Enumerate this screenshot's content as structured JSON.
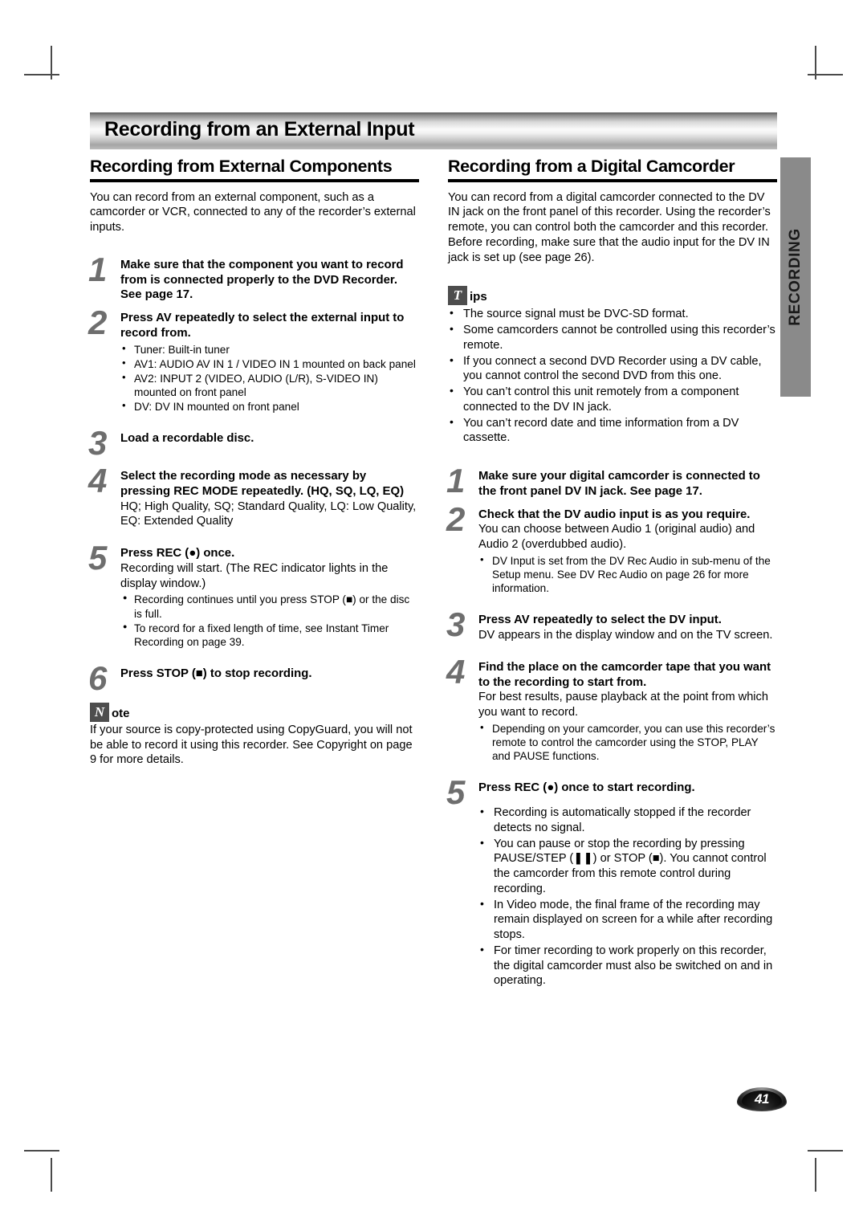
{
  "banner": {
    "title": "Recording from an External Input"
  },
  "side_tab": {
    "label": "RECORDING"
  },
  "page_number": "41",
  "left_column": {
    "heading": "Recording from External Components",
    "intro": "You can record from an external component, such as a camcorder or VCR, connected to any of the recorder’s external inputs.",
    "steps": [
      {
        "number": "1",
        "title": "Make sure that the component you want to record from is connected properly to the DVD Recorder. See page 17."
      },
      {
        "number": "2",
        "title": "Press AV repeatedly to select the external input to record from.",
        "bullets": [
          "Tuner: Built-in tuner",
          "AV1: AUDIO AV IN 1 / VIDEO IN 1 mounted on back panel",
          "AV2: INPUT 2 (VIDEO, AUDIO (L/R), S-VIDEO IN) mounted on front panel",
          "DV: DV IN mounted on front panel"
        ]
      },
      {
        "number": "3",
        "title": "Load a recordable disc."
      },
      {
        "number": "4",
        "title": "Select the recording mode as necessary by pressing REC MODE repeatedly. (HQ, SQ, LQ, EQ)",
        "sub": "HQ; High Quality, SQ; Standard Quality, LQ: Low Quality, EQ: Extended Quality"
      },
      {
        "number": "5",
        "title": "Press REC (●) once.",
        "sub": "Recording will start. (The REC indicator lights in the display window.)",
        "bullets": [
          "Recording continues until you press STOP (■) or the disc is full.",
          "To record for a fixed length of time, see Instant Timer Recording on page 39."
        ]
      },
      {
        "number": "6",
        "title": "Press STOP (■) to stop recording."
      }
    ],
    "note": {
      "badge": "N",
      "word": "ote",
      "text": "If your source is copy-protected using CopyGuard, you will not be able to record it using this recorder. See Copyright on page 9 for more details."
    }
  },
  "right_column": {
    "heading": "Recording from a Digital Camcorder",
    "intro_1": "You can record from a digital camcorder connected to the DV IN jack on the front panel of this recorder. Using the recorder’s remote, you can control both the camcorder and this recorder.",
    "intro_2": "Before recording, make sure that the audio input for the DV IN jack is set up (see page 26).",
    "tips": {
      "badge": "T",
      "word": "ips",
      "bullets": [
        "The source signal must be DVC-SD format.",
        "Some camcorders cannot be controlled using this recorder’s remote.",
        "If you connect a second DVD Recorder using a DV cable, you cannot control the second DVD from this one.",
        "You can’t control this unit remotely from a component connected to the DV IN jack.",
        "You can’t record date and time information from a DV cassette."
      ]
    },
    "steps": [
      {
        "number": "1",
        "title": "Make sure your digital camcorder is connected to the front panel DV IN jack. See page 17."
      },
      {
        "number": "2",
        "title": "Check that the DV audio input is as you require.",
        "sub": "You can choose between Audio 1 (original audio) and Audio 2 (overdubbed audio).",
        "bullets": [
          "DV Input is set from the DV Rec Audio in sub-menu of the Setup menu. See DV Rec Audio on page 26 for more information."
        ]
      },
      {
        "number": "3",
        "title": "Press AV repeatedly to select the DV input.",
        "sub": "DV appears in the display window and on the TV screen."
      },
      {
        "number": "4",
        "title": "Find the place on the camcorder tape that you want to the recording to start from.",
        "sub": "For best results, pause playback at the point from which you want to record.",
        "bullets": [
          "Depending on your camcorder, you can use this recorder’s remote to control the camcorder using the STOP, PLAY and PAUSE functions."
        ]
      },
      {
        "number": "5",
        "title": "Press REC (●) once to start recording.",
        "bullets": [
          "Recording is automatically stopped if the recorder detects no signal.",
          "You can pause or stop the recording by pressing PAUSE/STEP (❚❚) or STOP (■). You cannot control the camcorder from this remote control during recording.",
          "In Video mode, the final frame of the recording may remain displayed on screen for a while after recording stops.",
          "For timer recording to work properly on this recorder, the digital camcorder must also be switched on and in operating."
        ]
      }
    ]
  }
}
